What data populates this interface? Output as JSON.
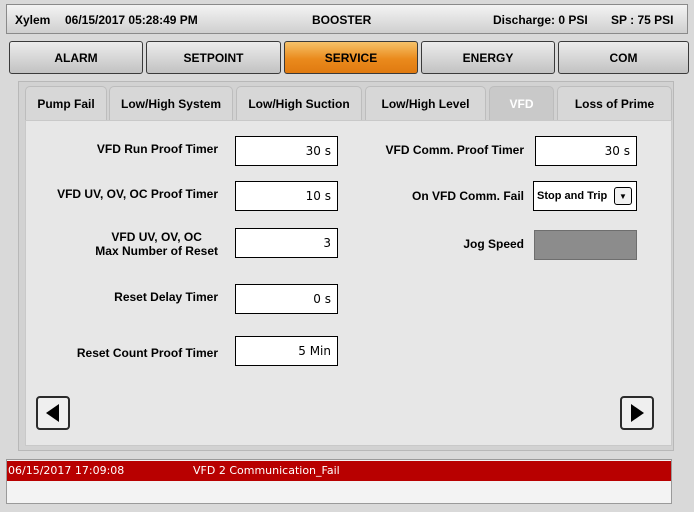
{
  "header": {
    "brand": "Xylem",
    "datetime": "06/15/2017 05:28:49 PM",
    "title": "BOOSTER",
    "discharge": "Discharge: 0 PSI",
    "setpoint": "SP : 75 PSI"
  },
  "main_nav": {
    "items": [
      "ALARM",
      "SETPOINT",
      "SERVICE",
      "ENERGY",
      "COM"
    ],
    "active": "SERVICE",
    "active_color": "#ea8a1c"
  },
  "sub_tabs": {
    "items": [
      "Pump Fail",
      "Low/High System",
      "Low/High Suction",
      "Low/High Level",
      "VFD",
      "Loss of Prime"
    ],
    "active": "VFD"
  },
  "form": {
    "vfd_run_proof_timer": {
      "label": "VFD Run Proof Timer",
      "value": "30 s"
    },
    "vfd_uv_ov_oc_proof_timer": {
      "label": "VFD UV, OV, OC Proof Timer",
      "value": "10 s"
    },
    "vfd_max_reset": {
      "label_line1": "VFD UV, OV, OC",
      "label_line2": "Max Number of Reset",
      "value": "3"
    },
    "reset_delay_timer": {
      "label": "Reset Delay Timer",
      "value": "0 s"
    },
    "reset_count_proof_timer": {
      "label": "Reset Count Proof Timer",
      "value": "5 Min"
    },
    "vfd_comm_proof_timer": {
      "label": "VFD Comm. Proof Timer",
      "value": "30 s"
    },
    "on_vfd_comm_fail": {
      "label": "On VFD Comm. Fail",
      "value": "Stop and Trip"
    },
    "jog_speed": {
      "label": "Jog Speed",
      "value": ""
    }
  },
  "icons": {
    "prev": "left-arrow-icon",
    "next": "right-arrow-icon",
    "dropdown": "dropdown-arrow-icon"
  },
  "alarm": {
    "timestamp": "06/15/2017 17:09:08",
    "message": "VFD 2 Communication_Fail",
    "color": "#b80000"
  }
}
